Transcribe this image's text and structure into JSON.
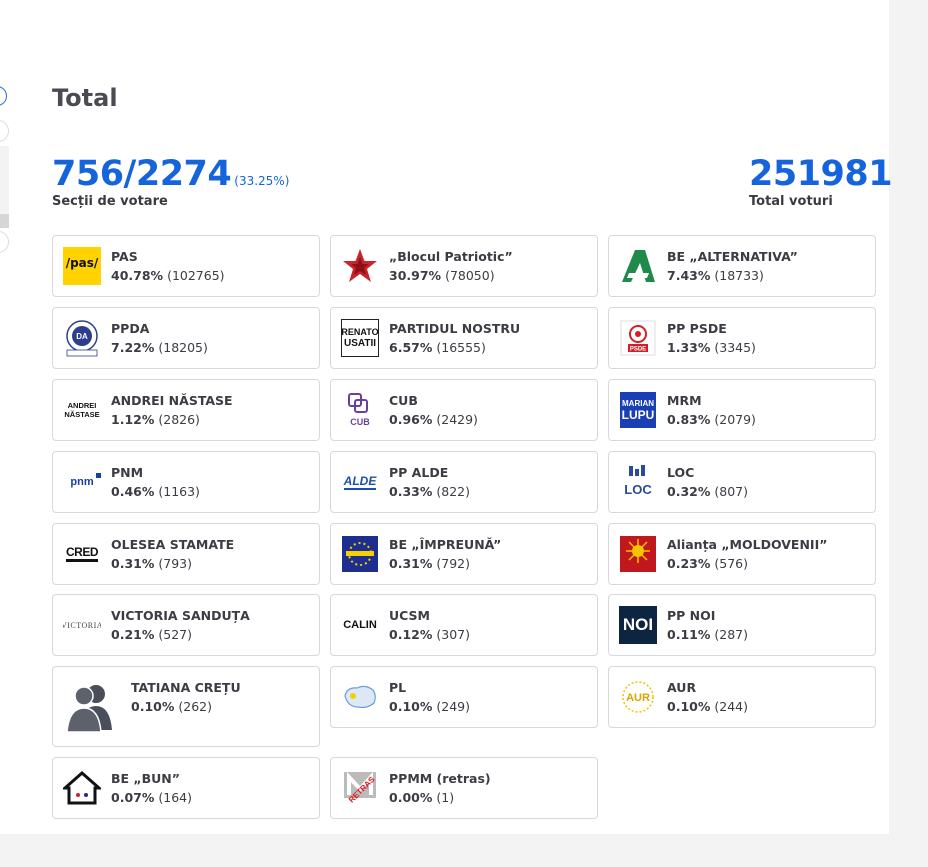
{
  "title": "Total",
  "sections": {
    "count": "756/2274",
    "percent": "(33.25%)",
    "label": "Secții de votare"
  },
  "votes": {
    "total": "251981",
    "label": "Total voturi"
  },
  "colors": {
    "accent": "#1664dc",
    "card_border": "#d8d8dc"
  },
  "parties": [
    {
      "name": "PAS",
      "percent": "40.78%",
      "votes": "(102765)",
      "logo": "pas-logo"
    },
    {
      "name": "„Blocul Patriotic”",
      "percent": "30.97%",
      "votes": "(78050)",
      "logo": "red-star-logo"
    },
    {
      "name": "BE „ALTERNATIVA”",
      "percent": "7.43%",
      "votes": "(18733)",
      "logo": "alternativa-logo"
    },
    {
      "name": "PPDA",
      "percent": "7.22%",
      "votes": "(18205)",
      "logo": "ppda-logo"
    },
    {
      "name": "PARTIDUL NOSTRU",
      "percent": "6.57%",
      "votes": "(16555)",
      "logo": "renato-usatii-logo",
      "logo_text": [
        "RENATO",
        "USATII"
      ]
    },
    {
      "name": "PP PSDE",
      "percent": "1.33%",
      "votes": "(3345)",
      "logo": "psde-logo",
      "logo_text": [
        "PSDE"
      ]
    },
    {
      "name": "ANDREI NĂSTASE",
      "percent": "1.12%",
      "votes": "(2826)",
      "logo": "andrei-nastase-logo",
      "logo_text": [
        "ANDREI",
        "NĂSTASE"
      ]
    },
    {
      "name": "CUB",
      "percent": "0.96%",
      "votes": "(2429)",
      "logo": "cub-logo",
      "logo_text": [
        "CUB"
      ]
    },
    {
      "name": "MRM",
      "percent": "0.83%",
      "votes": "(2079)",
      "logo": "marian-lupu-logo",
      "logo_text": [
        "MARIAN",
        "LUPU"
      ]
    },
    {
      "name": "PNM",
      "percent": "0.46%",
      "votes": "(1163)",
      "logo": "pnm-logo",
      "logo_text": [
        "pnm"
      ]
    },
    {
      "name": "PP ALDE",
      "percent": "0.33%",
      "votes": "(822)",
      "logo": "alde-logo",
      "logo_text": [
        "ALDE"
      ]
    },
    {
      "name": "LOC",
      "percent": "0.32%",
      "votes": "(807)",
      "logo": "loc-logo",
      "logo_text": [
        "LOC"
      ]
    },
    {
      "name": "OLESEA STAMATE",
      "percent": "0.31%",
      "votes": "(793)",
      "logo": "cred-logo",
      "logo_text": [
        "CRED"
      ]
    },
    {
      "name": "BE „ÎMPREUNĂ”",
      "percent": "0.31%",
      "votes": "(792)",
      "logo": "impreuna-logo"
    },
    {
      "name": "Alianța „MOLDOVENII”",
      "percent": "0.23%",
      "votes": "(576)",
      "logo": "moldovenii-logo"
    },
    {
      "name": "VICTORIA SANDUȚA",
      "percent": "0.21%",
      "votes": "(527)",
      "logo": "victoria-logo",
      "logo_text": [
        "VICTORIA"
      ]
    },
    {
      "name": "UCSM",
      "percent": "0.12%",
      "votes": "(307)",
      "logo": "calin-logo",
      "logo_text": [
        "CALIN"
      ]
    },
    {
      "name": "PP NOI",
      "percent": "0.11%",
      "votes": "(287)",
      "logo": "noi-logo",
      "logo_text": [
        "NOI"
      ]
    },
    {
      "name": "TATIANA CREȚU",
      "percent": "0.10%",
      "votes": "(262)",
      "logo": "person-silhouette-icon"
    },
    {
      "name": "PL",
      "percent": "0.10%",
      "votes": "(249)",
      "logo": "pl-map-logo"
    },
    {
      "name": "AUR",
      "percent": "0.10%",
      "votes": "(244)",
      "logo": "aur-logo",
      "logo_text": [
        "AUR"
      ]
    },
    {
      "name": "BE „BUN”",
      "percent": "0.07%",
      "votes": "(164)",
      "logo": "bun-house-logo"
    },
    {
      "name": "PPMM (retras)",
      "percent": "0.00%",
      "votes": "(1)",
      "logo": "ppmm-retras-logo",
      "logo_text": [
        "RETRAS"
      ]
    }
  ]
}
